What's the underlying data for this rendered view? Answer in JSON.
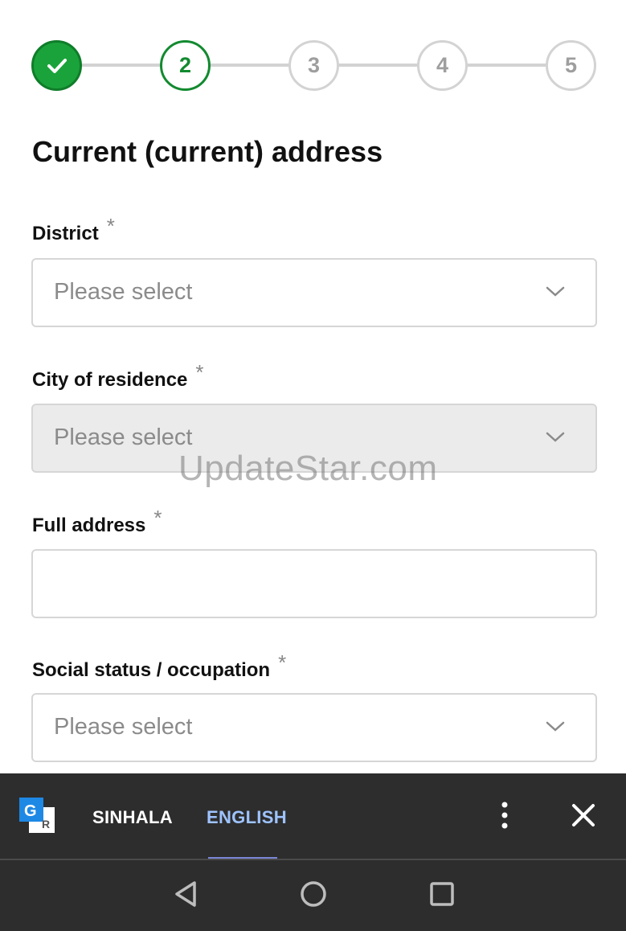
{
  "stepper": {
    "steps": [
      {
        "label": "",
        "state": "done"
      },
      {
        "label": "2",
        "state": "active"
      },
      {
        "label": "3",
        "state": "pending"
      },
      {
        "label": "4",
        "state": "pending"
      },
      {
        "label": "5",
        "state": "pending"
      }
    ],
    "done_color": "#1aa33a",
    "active_color": "#138a30"
  },
  "form": {
    "title": "Current (current) address",
    "required_marker": "*",
    "district": {
      "label": "District",
      "value": "Please select"
    },
    "city": {
      "label": "City of residence",
      "value": "Please select",
      "disabled": true
    },
    "full_address": {
      "label": "Full address",
      "value": ""
    },
    "occupation": {
      "label": "Social status / occupation",
      "value": "Please select"
    }
  },
  "watermark": "UpdateStar.com",
  "translate_bar": {
    "logo_icon": "google-translate-icon",
    "languages": [
      "SINHALA",
      "ENGLISH"
    ],
    "selected": "ENGLISH",
    "more_icon": "more-vert-icon",
    "close_icon": "close-icon"
  },
  "nav": {
    "back_icon": "back-triangle-icon",
    "home_icon": "home-circle-icon",
    "recents_icon": "recents-square-icon"
  }
}
